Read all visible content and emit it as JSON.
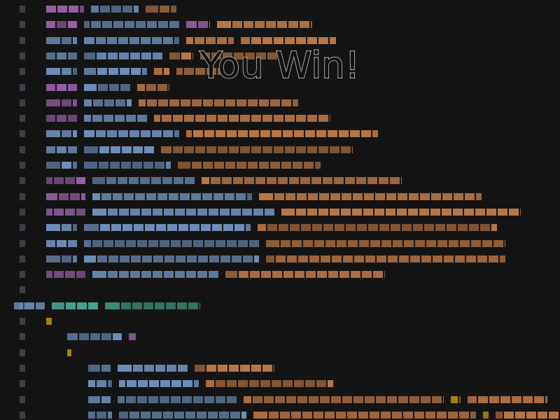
{
  "game": {
    "result_text": "You Win!"
  },
  "colors": {
    "background": "#141414",
    "keyword": "#b06fc2",
    "identifier": "#7fa6d8",
    "string": "#d98a4f",
    "type": "#4fbfa5",
    "brace": "#d9a400",
    "line_number": "#3c3f4a"
  }
}
